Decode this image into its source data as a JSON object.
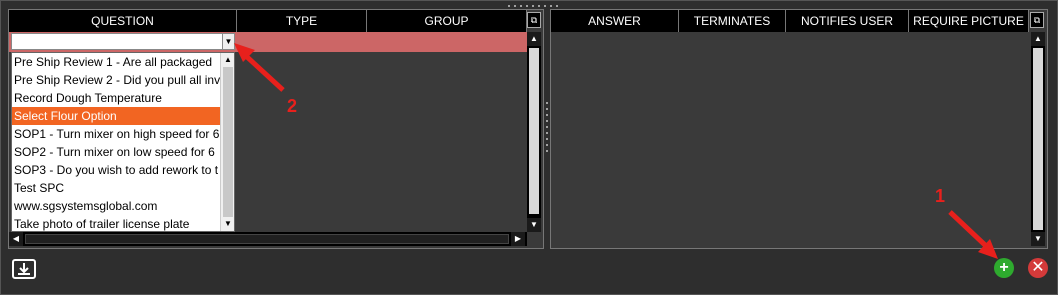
{
  "question_grid": {
    "columns": [
      "QUESTION",
      "TYPE",
      "GROUP"
    ],
    "dropdown_items": [
      "Pre Ship Review 1 - Are all packaged",
      "Pre Ship Review 2 - Did you pull all inv",
      "Record Dough Temperature",
      "Select Flour Option",
      "SOP1 - Turn mixer on high speed for 6",
      "SOP2 - Turn mixer on low speed for 6",
      "SOP3 - Do you wish to add rework to t",
      "Test SPC",
      "www.sgsystemsglobal.com",
      "Take photo of trailer license plate"
    ],
    "selected_index": 3
  },
  "answer_grid": {
    "columns": [
      "ANSWER",
      "TERMINATES",
      "NOTIFIES USER",
      "REQUIRE PICTURE"
    ]
  },
  "annotations": {
    "callout_1": "1",
    "callout_2": "2",
    "color": "#e8201c"
  },
  "colors": {
    "selected_row": "#f26522",
    "edit_row": "#cc6666",
    "add_button": "#2eaa2e",
    "delete_button": "#d43a3a"
  },
  "icons": {
    "export": "export-tray-icon",
    "add": "plus-icon",
    "delete": "close-icon"
  }
}
